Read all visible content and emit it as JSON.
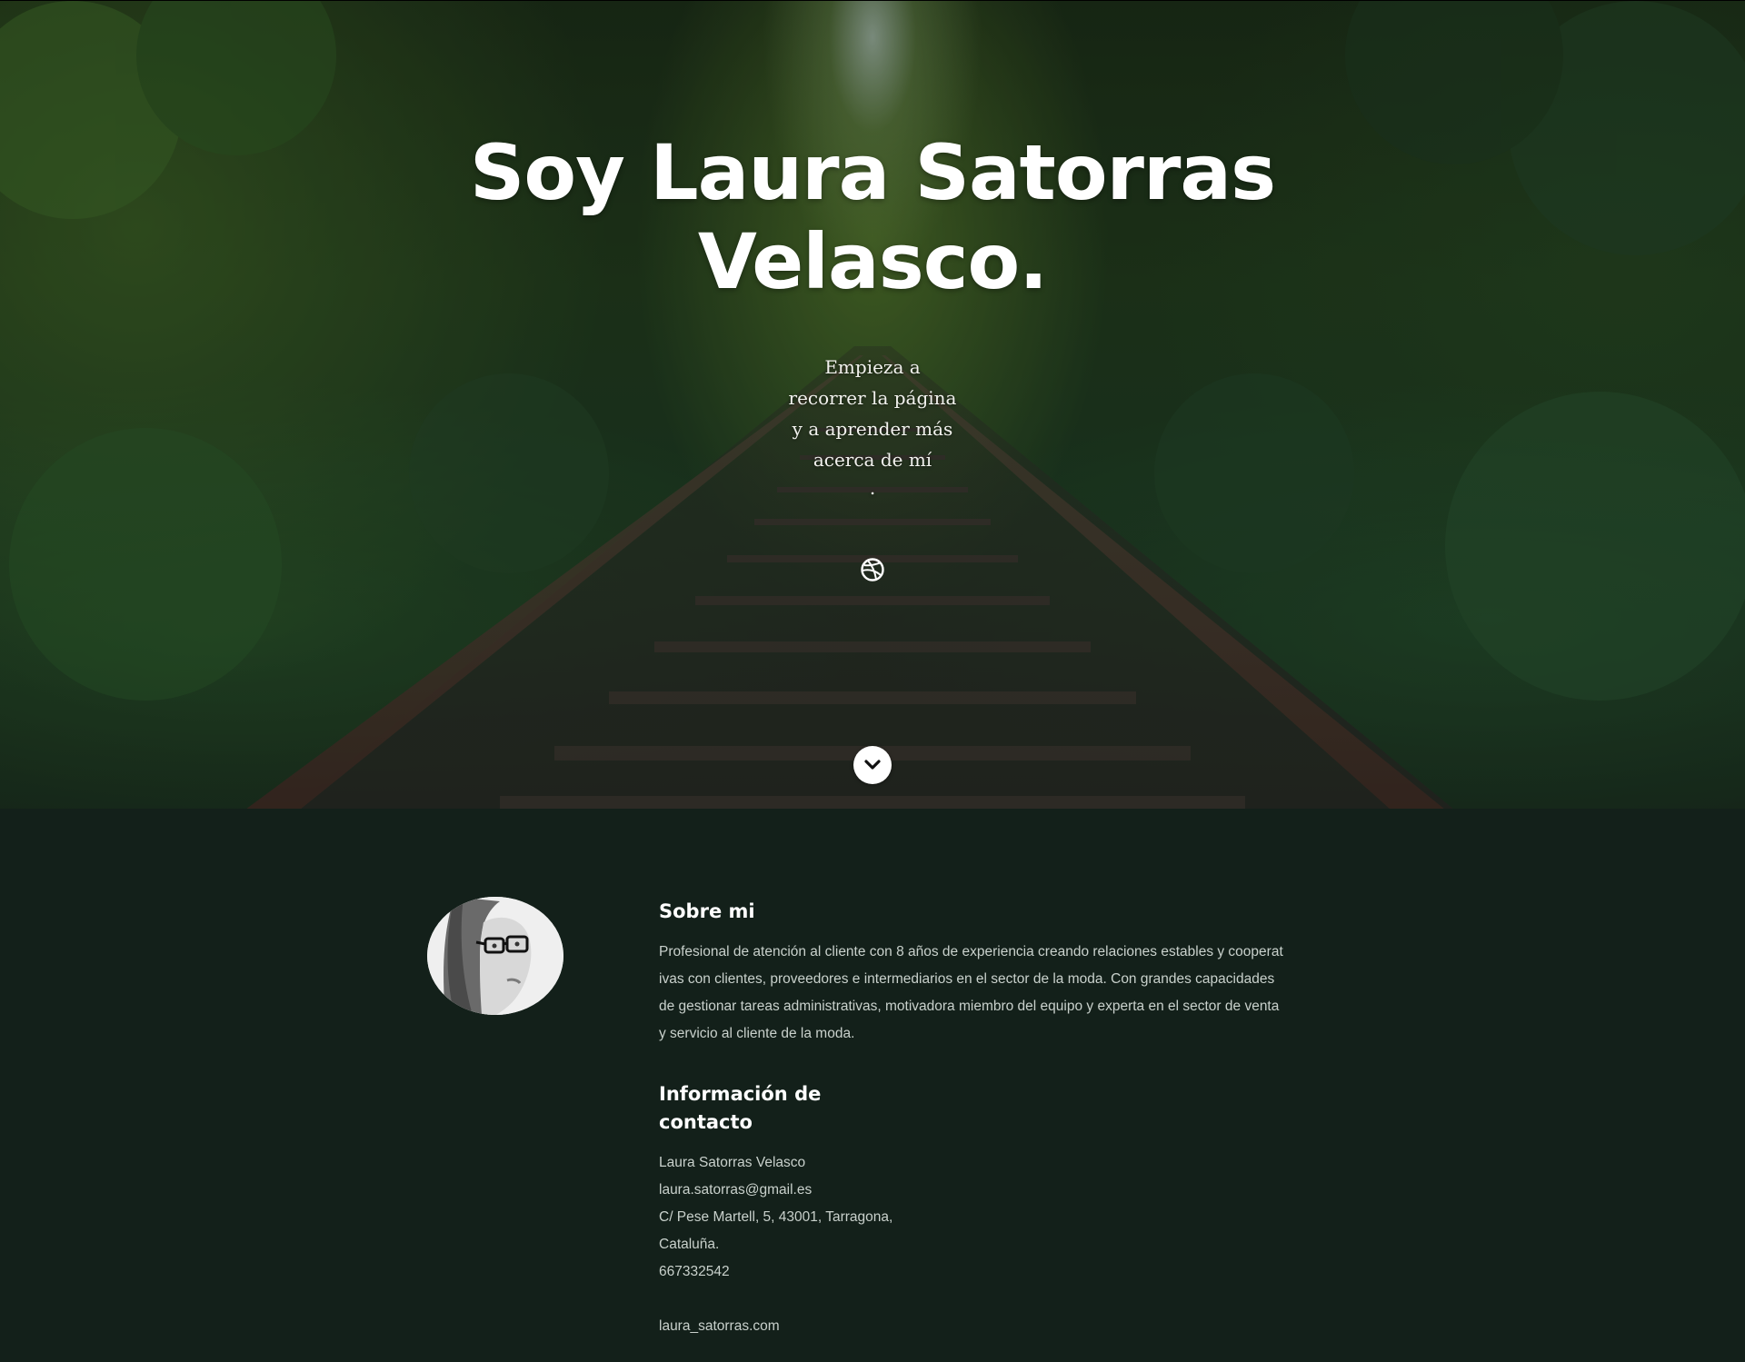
{
  "hero": {
    "title": "Soy Laura Satorras Velasco.",
    "subtitle_lines": [
      "Empieza a",
      "recorrer la página",
      "y a aprender más",
      "acerca de mí"
    ],
    "subtitle_dot": ".",
    "social_icon": "dribbble-icon",
    "scroll_icon": "chevron-down-icon"
  },
  "about": {
    "heading": "Sobre mi",
    "text": "Profesional de atención al cliente con 8 años de experiencia creando relaciones estables y cooperativas con clientes, proveedores e intermediarios en el sector de la moda. Con grandes capacidades de gestionar tareas administrativas, motivadora miembro del equipo y experta en el sector de venta y servicio al cliente de la moda."
  },
  "contact": {
    "heading": "Información de contacto",
    "name": "Laura Satorras Velasco",
    "email": "laura.satorras@gmail.es",
    "address": "C/ Pese Martell, 5, 43001, Tarragona, Cataluña.",
    "phone": "667332542",
    "website": "laura_satorras.com"
  },
  "colors": {
    "footer_bg": "#13201a",
    "text_light": "#c9d1cc",
    "heading": "#ffffff"
  }
}
